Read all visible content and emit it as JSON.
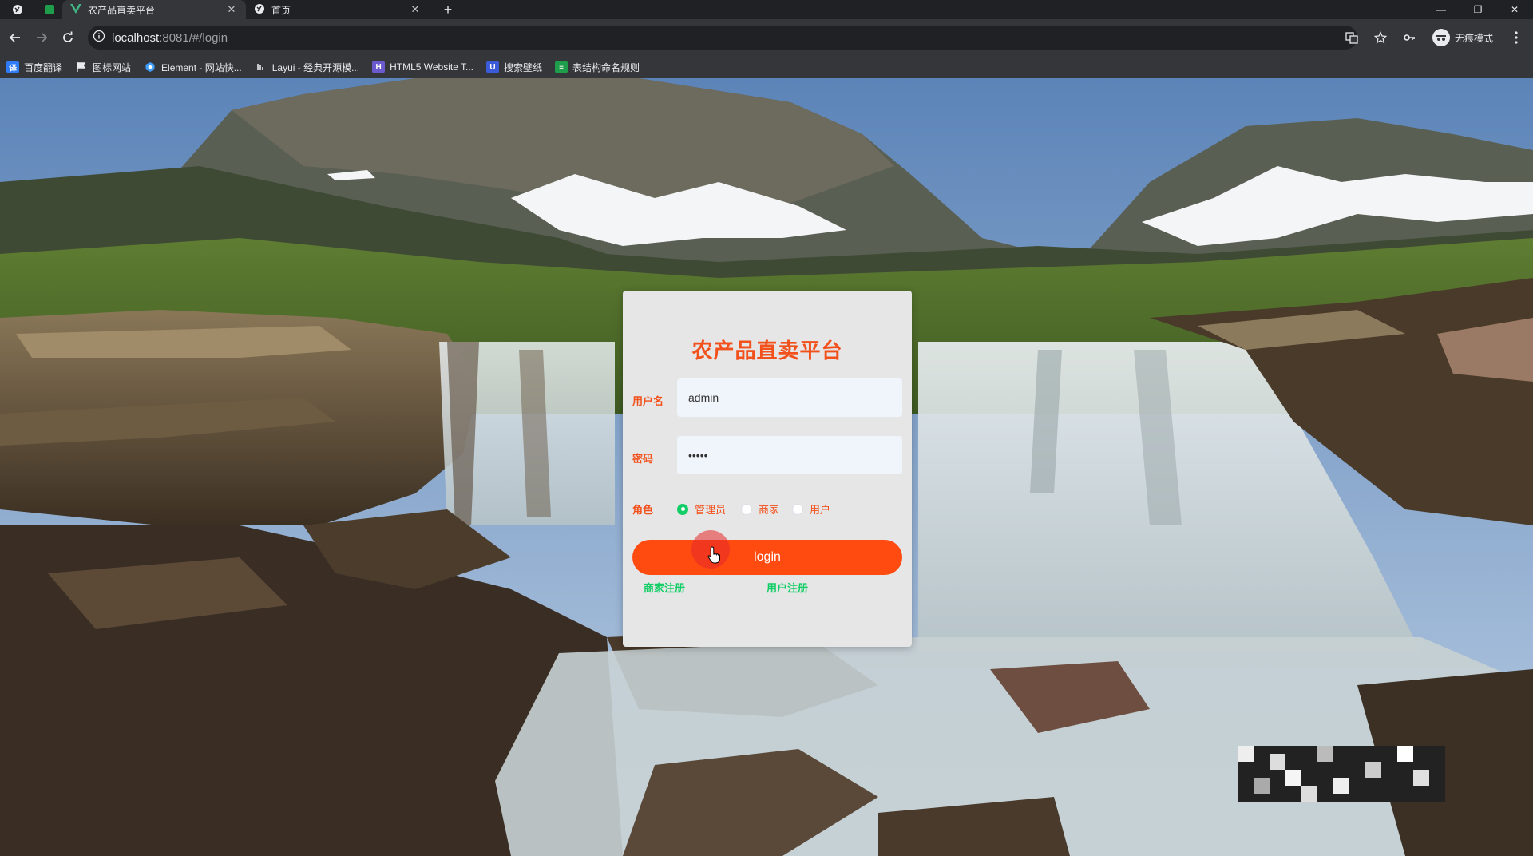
{
  "browser": {
    "tabs": [
      {
        "label": "农产品直卖平台",
        "active": true
      },
      {
        "label": "首页",
        "active": false
      }
    ],
    "url_host": "localhost",
    "url_path": ":8081/#/login",
    "incognito_label": "无痕模式",
    "bookmarks": [
      {
        "label": "百度翻译",
        "icon": "translate-icon",
        "color": "#2f7cf6"
      },
      {
        "label": "图标网站",
        "icon": "flag-icon",
        "color": "#35363a"
      },
      {
        "label": "Element - 网站快...",
        "icon": "element-icon",
        "color": "#409eff"
      },
      {
        "label": "Layui - 经典开源模...",
        "icon": "layui-icon",
        "color": "#35363a"
      },
      {
        "label": "HTML5 Website T...",
        "icon": "html5-icon",
        "color": "#6a5acd"
      },
      {
        "label": "搜索壁纸",
        "icon": "wallpaper-icon",
        "color": "#3b5bdb"
      },
      {
        "label": "表结构命名规则",
        "icon": "doc-icon",
        "color": "#1e9e4a"
      }
    ]
  },
  "login": {
    "title": "农产品直卖平台",
    "username_label": "用户名",
    "username_value": "admin",
    "password_label": "密码",
    "password_value": "•••••",
    "role_label": "角色",
    "roles": [
      {
        "label": "管理员",
        "selected": true
      },
      {
        "label": "商家",
        "selected": false
      },
      {
        "label": "用户",
        "selected": false
      }
    ],
    "login_button": "login",
    "merchant_register": "商家注册",
    "user_register": "用户注册"
  },
  "colors": {
    "accent": "#f2511b",
    "button": "#ff4a10",
    "link": "#13ce66"
  }
}
